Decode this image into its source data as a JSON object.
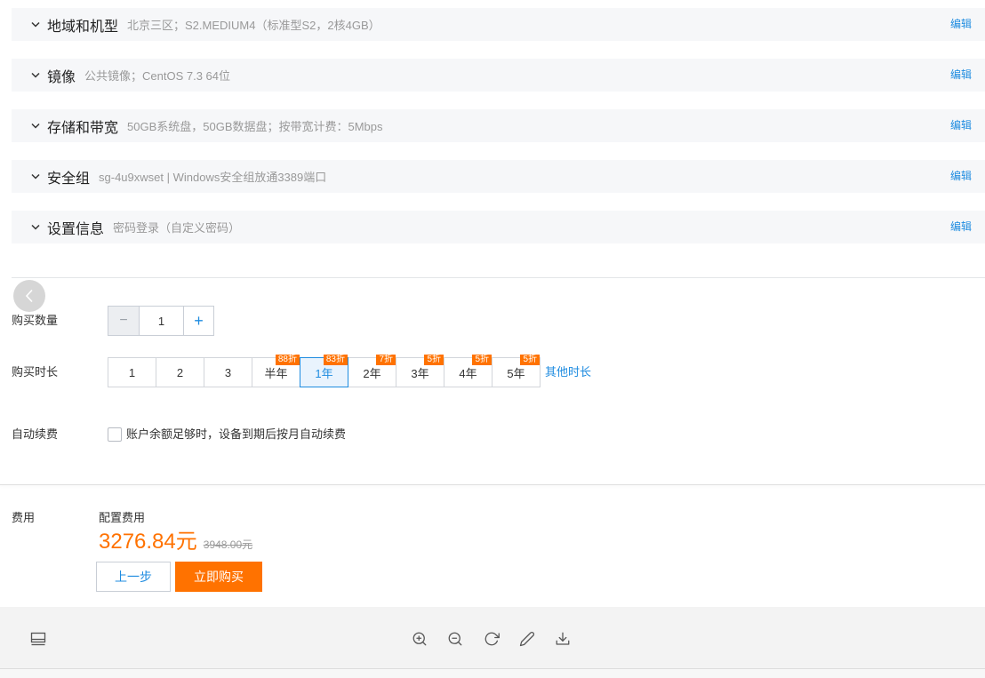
{
  "sections": [
    {
      "title": "地域和机型",
      "summary": "北京三区；S2.MEDIUM4（标准型S2，2核4GB）",
      "edit_label": "编辑",
      "icon": "chevron-down-icon"
    },
    {
      "title": "镜像",
      "summary": "公共镜像；CentOS 7.3 64位",
      "edit_label": "编辑",
      "icon": "chevron-down-icon"
    },
    {
      "title": "存储和带宽",
      "summary": "50GB系统盘，50GB数据盘；按带宽计费：5Mbps",
      "edit_label": "编辑",
      "icon": "chevron-down-icon"
    },
    {
      "title": "安全组",
      "summary": "sg-4u9xwset | Windows安全组放通3389端口",
      "edit_label": "编辑",
      "icon": "chevron-down-icon"
    },
    {
      "title": "设置信息",
      "summary": "密码登录（自定义密码）",
      "edit_label": "编辑",
      "icon": "chevron-down-icon"
    }
  ],
  "carousel": {
    "back_icon": "chevron-left-icon"
  },
  "quantity": {
    "label": "购买数量",
    "minus_label": "−",
    "value": "1",
    "plus_label": "+"
  },
  "duration": {
    "label": "购买时长",
    "options": [
      {
        "label": "1"
      },
      {
        "label": "2"
      },
      {
        "label": "3"
      },
      {
        "label": "半年",
        "badge": "88折"
      },
      {
        "label": "1年",
        "badge": "83折",
        "selected": true
      },
      {
        "label": "2年",
        "badge": "7折"
      },
      {
        "label": "3年",
        "badge": "5折"
      },
      {
        "label": "4年",
        "badge": "5折"
      },
      {
        "label": "5年",
        "badge": "5折"
      }
    ],
    "other_label": "其他时长"
  },
  "auto_renew": {
    "label": "自动续费",
    "checkbox_text": "账户余额足够时，设备到期后按月自动续费",
    "checked": false
  },
  "fee": {
    "label": "费用",
    "config_label": "配置费用",
    "price": "3276.84元",
    "original_price": "3948.00元"
  },
  "actions": {
    "prev_label": "上一步",
    "buy_label": "立即购买"
  },
  "toolbar": {
    "left_icon": "monitor-icon",
    "icons": [
      "zoom-in-icon",
      "zoom-out-icon",
      "rotate-icon",
      "edit-icon",
      "download-icon"
    ]
  },
  "colors": {
    "accent": "#1f8ce0",
    "price": "#ff7200",
    "buy_button": "#ff7200",
    "badge": "#ff7200",
    "section_bg": "#f6f7f9",
    "muted_text": "#999999"
  }
}
